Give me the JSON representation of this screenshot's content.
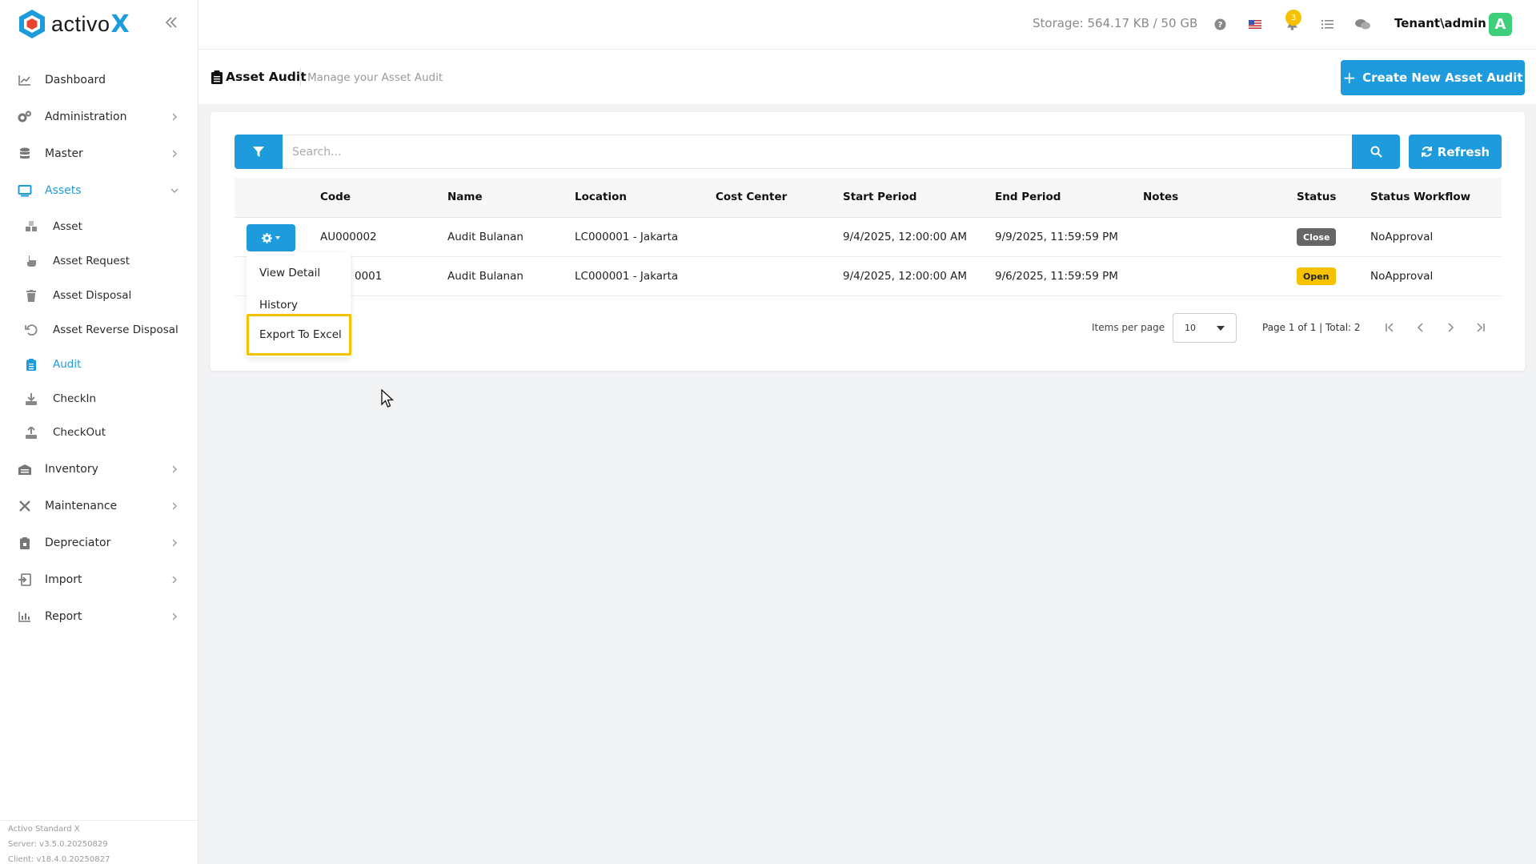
{
  "brand": {
    "name": "activo",
    "suffix": "X"
  },
  "topbar": {
    "storage": "Storage: 564.17 KB / 50 GB",
    "notification_count": "3",
    "user": "Tenant\\admin",
    "avatar_letter": "A"
  },
  "sidebar": {
    "items": [
      {
        "label": "Dashboard",
        "icon": "chart-line-icon"
      },
      {
        "label": "Administration",
        "icon": "cogs-icon"
      },
      {
        "label": "Master",
        "icon": "database-icon"
      },
      {
        "label": "Assets",
        "icon": "monitor-icon"
      },
      {
        "label": "Inventory",
        "icon": "warehouse-icon"
      },
      {
        "label": "Maintenance",
        "icon": "tools-icon"
      },
      {
        "label": "Depreciator",
        "icon": "clipboard-icon"
      },
      {
        "label": "Import",
        "icon": "import-icon"
      },
      {
        "label": "Report",
        "icon": "bar-chart-icon"
      }
    ],
    "asset_subitems": [
      {
        "label": "Asset",
        "icon": "boxes-icon"
      },
      {
        "label": "Asset Request",
        "icon": "hand-icon"
      },
      {
        "label": "Asset Disposal",
        "icon": "trash-icon"
      },
      {
        "label": "Asset Reverse Disposal",
        "icon": "undo-icon"
      },
      {
        "label": "Audit",
        "icon": "clipboard-list-icon"
      },
      {
        "label": "CheckIn",
        "icon": "download-icon"
      },
      {
        "label": "CheckOut",
        "icon": "upload-icon"
      }
    ],
    "footer": {
      "product": "Activo Standard X",
      "server": "Server: v3.5.0.20250829",
      "client": "Client: v18.4.0.20250827"
    }
  },
  "page": {
    "title": "Asset Audit",
    "subtitle": "Manage your Asset Audit",
    "create_label": "Create New Asset Audit"
  },
  "search": {
    "placeholder": "Search...",
    "refresh_label": "Refresh"
  },
  "table": {
    "columns": [
      "Code",
      "Name",
      "Location",
      "Cost Center",
      "Start Period",
      "End Period",
      "Notes",
      "Status",
      "Status Workflow"
    ],
    "rows": [
      {
        "code": "AU000002",
        "name": "Audit Bulanan",
        "location": "LC000001 - Jakarta",
        "cost_center": "",
        "start": "9/4/2025, 12:00:00 AM",
        "end": "9/9/2025, 11:59:59 PM",
        "notes": "",
        "status": "Close",
        "workflow": "NoApproval"
      },
      {
        "code": "AU000001",
        "code_visible": "0001",
        "name": "Audit Bulanan",
        "location": "LC000001 - Jakarta",
        "cost_center": "",
        "start": "9/4/2025, 12:00:00 AM",
        "end": "9/6/2025, 11:59:59 PM",
        "notes": "",
        "status": "Open",
        "workflow": "NoApproval"
      }
    ]
  },
  "pagination": {
    "items_per_page_label": "Items per page",
    "items_per_page": "10",
    "page_info": "Page 1 of 1 | Total: 2"
  },
  "dropdown": {
    "items": [
      "View Detail",
      "History",
      "Export To Excel"
    ]
  },
  "colors": {
    "accent": "#1e9bdc",
    "close": "#666666",
    "open": "#f6c200",
    "highlight": "#f6c200"
  }
}
